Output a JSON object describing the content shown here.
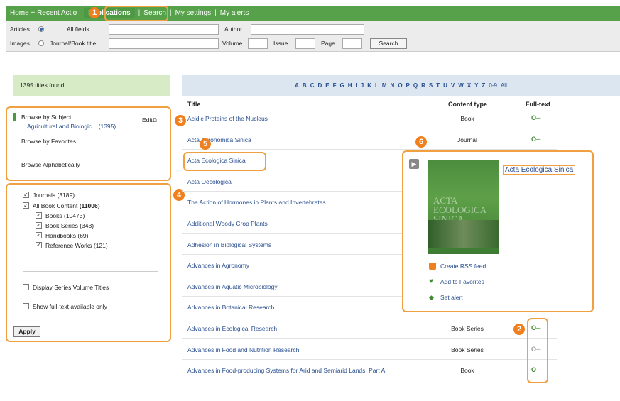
{
  "nav": {
    "home": "Home + Recent Actio",
    "publications": "Publications",
    "search": "Search",
    "settings": "My settings",
    "alerts": "My alerts",
    "sep": "|"
  },
  "search": {
    "articles": "Articles",
    "images": "Images",
    "all_fields": "All fields",
    "journal_title": "Journal/Book title",
    "author": "Author",
    "volume": "Volume",
    "issue": "Issue",
    "page": "Page",
    "search_button": "Search"
  },
  "results": {
    "found": "1395 titles found",
    "alphabet": [
      "A",
      "B",
      "C",
      "D",
      "E",
      "F",
      "G",
      "H",
      "I",
      "J",
      "K",
      "L",
      "M",
      "N",
      "O",
      "P",
      "Q",
      "R",
      "S",
      "T",
      "U",
      "V",
      "W",
      "X",
      "Y",
      "Z",
      "0-9",
      "All"
    ]
  },
  "browse": {
    "by_subject": "Browse by Subject",
    "subject_selected": "Agricultural and Biologic... (1395)",
    "edit": "Edit",
    "by_favorites": "Browse by Favorites",
    "alphabetically": "Browse Alphabetically"
  },
  "filters": {
    "journals": "Journals (3189)",
    "all_books_prefix": "All Book Content",
    "all_books_count": "(11006)",
    "books": "Books (10473)",
    "book_series": "Book Series (343)",
    "handbooks": "Handbooks (69)",
    "reference_works": "Reference Works (121)",
    "display_series": "Display Series Volume Titles",
    "fulltext_only": "Show full-text available only",
    "apply": "Apply"
  },
  "table": {
    "col_title": "Title",
    "col_type": "Content type",
    "col_fulltext": "Full-text",
    "rows": [
      {
        "title": "Acidic Proteins of the Nucleus",
        "type": "Book",
        "key": "green"
      },
      {
        "title": "Acta Agronomica Sinica",
        "type": "Journal",
        "key": "green"
      },
      {
        "title": "Acta Ecologica Sinica",
        "type": "",
        "key": ""
      },
      {
        "title": "Acta Oecologica",
        "type": "",
        "key": ""
      },
      {
        "title": "The Action of Hormones in Plants and Invertebrates",
        "type": "",
        "key": ""
      },
      {
        "title": "Additional Woody Crop Plants",
        "type": "",
        "key": ""
      },
      {
        "title": "Adhesion in Biological Systems",
        "type": "",
        "key": ""
      },
      {
        "title": "Advances in Agronomy",
        "type": "",
        "key": ""
      },
      {
        "title": "Advances in Aquatic Microbiology",
        "type": "",
        "key": ""
      },
      {
        "title": "Advances in Botanical Research",
        "type": "",
        "key": ""
      },
      {
        "title": "Advances in Ecological Research",
        "type": "Book Series",
        "key": "green"
      },
      {
        "title": "Advances in Food and Nutrition Research",
        "type": "Book Series",
        "key": "gray"
      },
      {
        "title": "Advances in Food-producing Systems for Arid and Semiarid Lands, Part A",
        "type": "Book",
        "key": "green"
      }
    ]
  },
  "popup": {
    "title": "Acta Ecologica Sinica",
    "cover_text": "ACTA ECOLOGICA SINICA",
    "rss": "Create RSS feed",
    "favorites": "Add to Favorites",
    "alert": "Set alert"
  },
  "badges": [
    "1",
    "2",
    "3",
    "4",
    "5",
    "6"
  ],
  "colors": {
    "nav_green": "#56a14a",
    "highlight_orange": "#f0a040",
    "link_blue": "#2a4f8f",
    "key_green": "#3d8a2f"
  }
}
